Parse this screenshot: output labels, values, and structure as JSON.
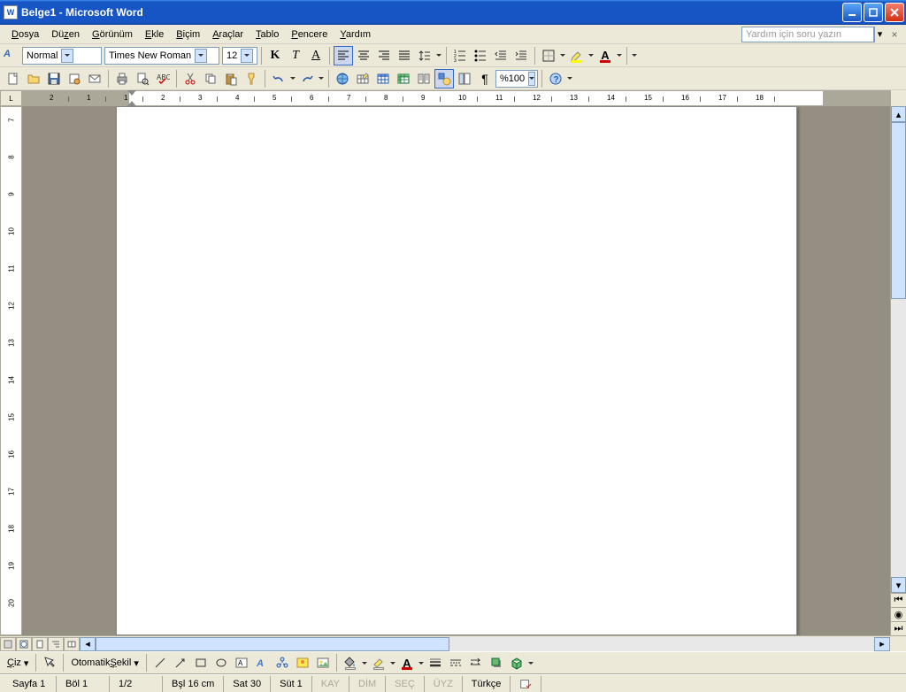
{
  "title": "Belge1 - Microsoft Word",
  "menu": [
    "Dosya",
    "Düzen",
    "Görünüm",
    "Ekle",
    "Biçim",
    "Araçlar",
    "Tablo",
    "Pencere",
    "Yardım"
  ],
  "help_placeholder": "Yardım için soru yazın",
  "formatting": {
    "style": "Normal",
    "font": "Times New Roman",
    "size": "12",
    "bold": "K",
    "italic": "T",
    "underline": "A"
  },
  "standard": {
    "zoom": "%100"
  },
  "hruler_marks": [
    "2",
    "1",
    "1",
    "2",
    "3",
    "4",
    "5",
    "6",
    "7",
    "8",
    "9",
    "10",
    "11",
    "12",
    "13",
    "14",
    "15",
    "16",
    "17",
    "18"
  ],
  "vruler_marks": [
    "7",
    "8",
    "9",
    "10",
    "11",
    "12",
    "13",
    "14",
    "15",
    "16",
    "17",
    "18",
    "19",
    "20"
  ],
  "drawing": {
    "draw_label": "Çiz",
    "autoshape_label": "Otomatik Şekil"
  },
  "status": {
    "page": "Sayfa  1",
    "section": "Böl  1",
    "pages": "1/2",
    "position": "Bşl  16 cm",
    "line": "Sat  30",
    "column": "Süt  1",
    "kay": "KAY",
    "dim": "DİM",
    "sec": "SEÇ",
    "uyz": "ÜYZ",
    "lang": "Türkçe"
  }
}
